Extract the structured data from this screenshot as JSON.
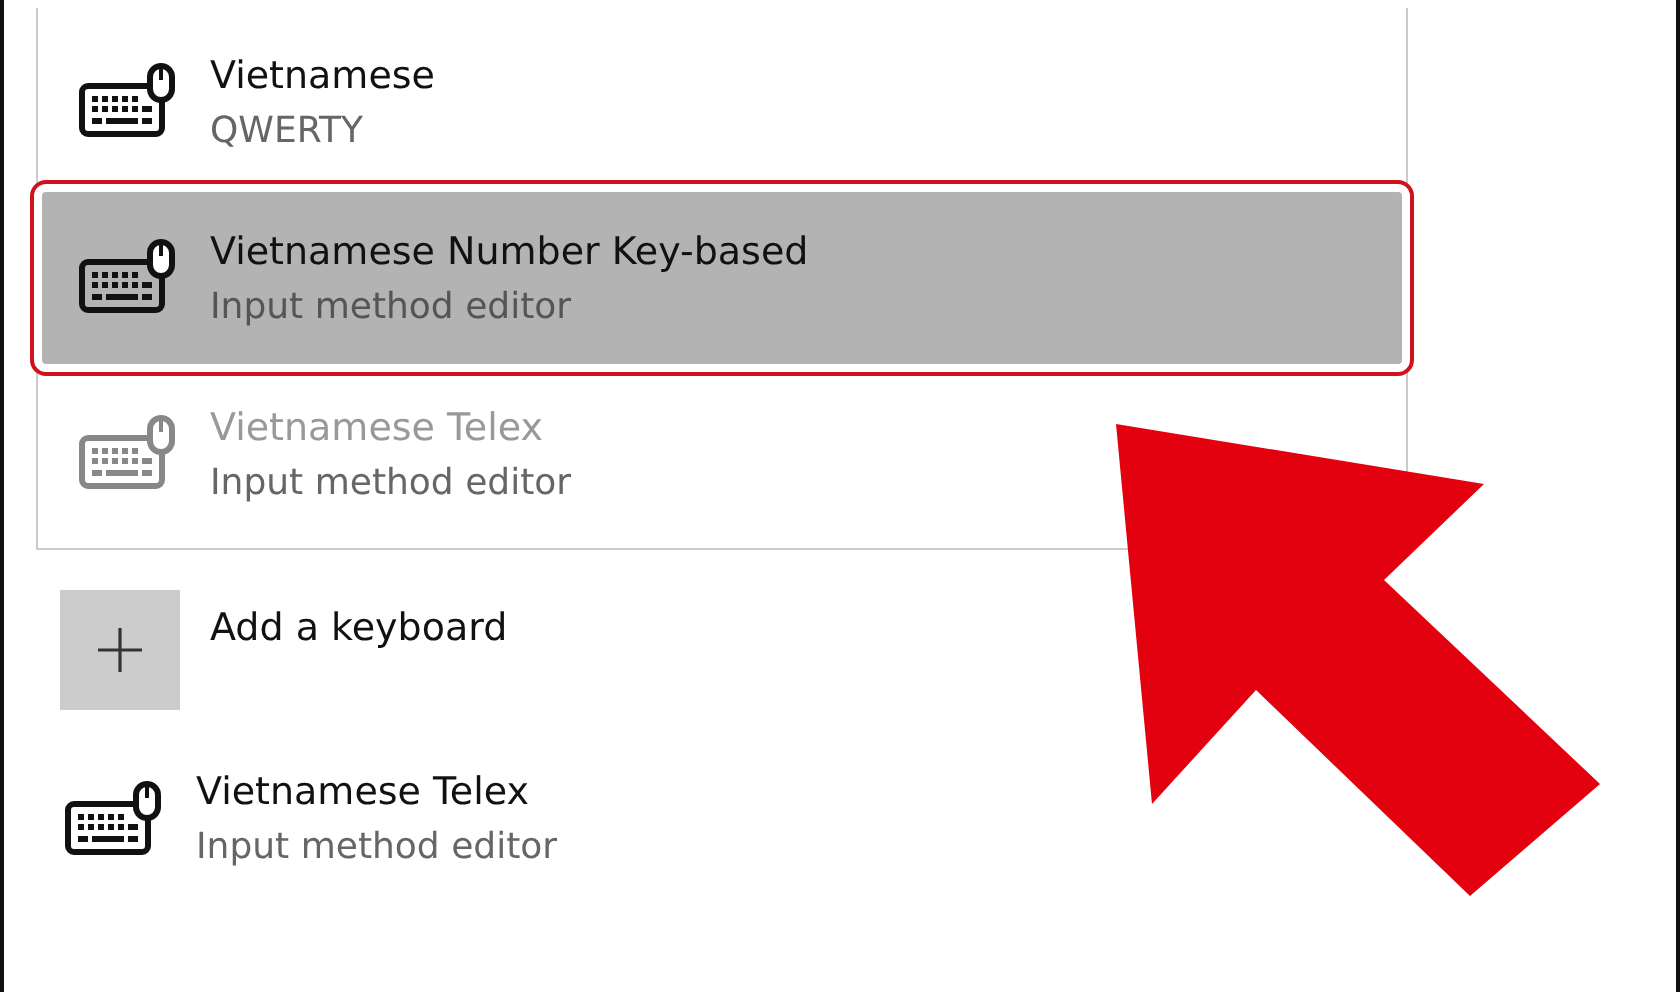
{
  "dropdown": {
    "items": [
      {
        "title": "Vietnamese",
        "subtitle": "QWERTY",
        "selected": false,
        "disabled": false
      },
      {
        "title": "Vietnamese Number Key-based",
        "subtitle": "Input method editor",
        "selected": true,
        "disabled": false
      },
      {
        "title": "Vietnamese Telex",
        "subtitle": "Input method editor",
        "selected": false,
        "disabled": true
      }
    ]
  },
  "add_button": {
    "label": "Add a keyboard"
  },
  "keyboards": [
    {
      "title": "Vietnamese Telex",
      "subtitle": "Input method editor"
    }
  ]
}
